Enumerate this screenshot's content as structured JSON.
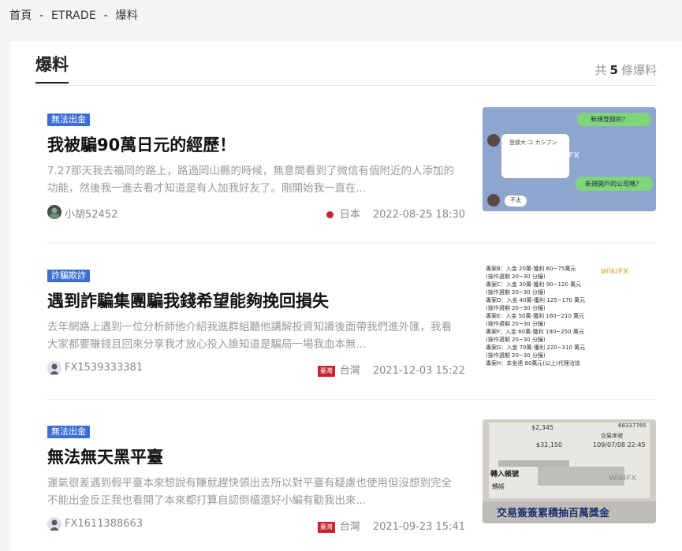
{
  "breadcrumb": {
    "home": "首頁",
    "sep": "-",
    "broker": "ETRADE",
    "current": "爆料"
  },
  "header": {
    "title": "爆料",
    "count_prefix": "共",
    "count": "5",
    "count_suffix": "條爆料"
  },
  "items": [
    {
      "tag": "無法出金",
      "title": "我被騙90萬日元的經歷！",
      "excerpt": "7.27那天我去福岡的路上，路過岡山縣的時候，無意間看到了微信有個附近的人添加的功能，然後我一進去看才知道是有人加我好友了。剛開始我一直在...",
      "user": "小胡52452",
      "country": "日本",
      "date": "2022-08-25 18:30",
      "thumb": {
        "bubble1": "新規登録的？",
        "bubble2": "新規開戶的公司嗎？",
        "name": "登録大 コ カシブン",
        "small": "不太",
        "watermark": "WikiFX"
      }
    },
    {
      "tag": "詐騙欺詐",
      "title": "遇到詐騙集團騙我錢希望能夠挽回損失",
      "excerpt": "去年網路上遇到一位分析師他介紹我進群組聽他講解投資知識後面帶我們進外匯，我看大家都要賺錢且回來分享我才放心投入誰知道是騙局一場我血本無...",
      "user": "FX1539333381",
      "flag": "臺灣",
      "country": "台灣",
      "date": "2021-12-03 15:22",
      "thumb": {
        "lines": [
          "專案B：入金 20萬-獲利 60~75萬元",
          "(操作週期 20~30 分鐘)",
          "專案C：入金 30萬-獲利 90~120 萬元",
          "(操作週期 20~30 分鐘)",
          "專案D：入金 40萬-獲利 125~170 萬元",
          "(操作週期 20~30 分鐘)",
          "專案E：入金 50萬-獲利 160~210 萬元",
          "(操作週期 20~30 分鐘)",
          "專案F：入金 60萬-獲利 190~250 萬元",
          "(操作週期 20~30 分鐘)",
          "專案G：入金 70萬-獲利 220~310 萬元",
          "(操作週期 20~30 分鐘)",
          "專案H：本金達 80萬元(以上)代理洽談"
        ],
        "watermark": "WikiFX"
      }
    },
    {
      "tag": "無法出金",
      "title": "無法無天黑平臺",
      "excerpt": "運氣很差遇到假平臺本來想說有賺就趕快領出去所以對平臺有疑慮也使用但沒想到完全不能出金反正我也看開了本來都打算自認倒楣還好小編有勸我出來...",
      "user": "FX1611388663",
      "flag": "臺灣",
      "country": "台灣",
      "date": "2021-09-23 15:41",
      "thumb": {
        "amount1": "$2,345",
        "amount2": "$32,150",
        "ref": "68337765",
        "label1": "交易序號",
        "time": "109/07/08 22:45",
        "label2": "轉入帳號",
        "label3": "轉帳",
        "footer": "交易簽簽累積抽百萬獎金",
        "watermark": "WikiFX"
      }
    }
  ]
}
